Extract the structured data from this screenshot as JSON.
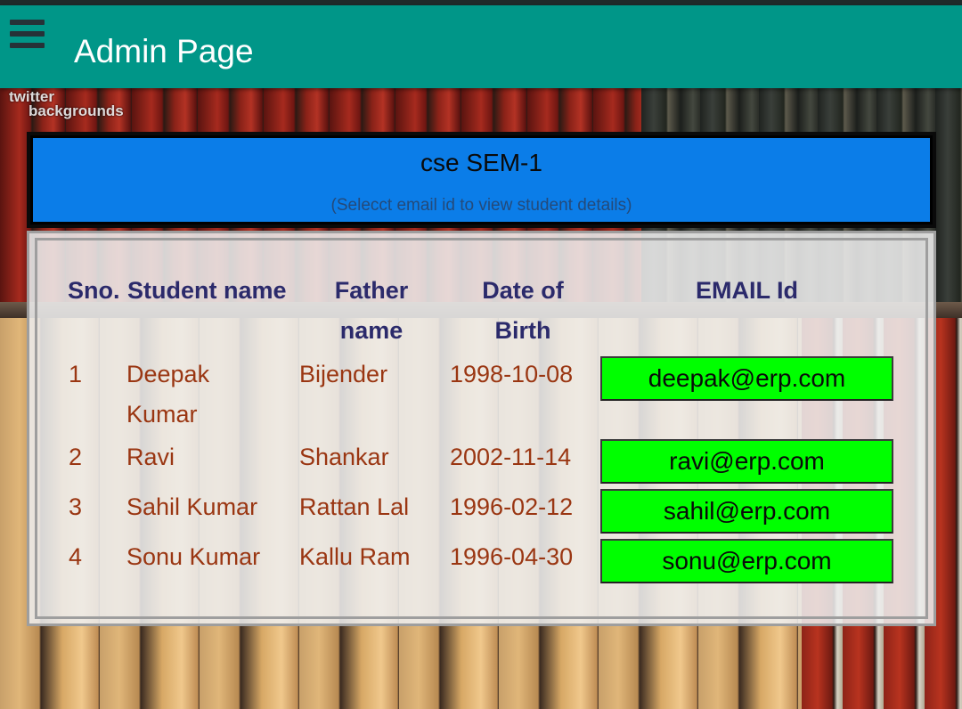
{
  "app_bar": {
    "title": "Admin Page",
    "menu_icon": "hamburger-menu-icon",
    "color": "#009688"
  },
  "background": {
    "watermark_line1": "twitter",
    "watermark_line2": "backgrounds"
  },
  "header": {
    "title": "cse SEM-1",
    "subtitle": "(Selecct email id to view student details)",
    "color": "#0b7de8"
  },
  "table": {
    "columns": {
      "sno": "Sno.",
      "student_name": "Student name",
      "father_name_1": "Father",
      "father_name_2": "name",
      "dob_1": "Date of",
      "dob_2": "Birth",
      "email": "EMAIL Id"
    },
    "rows": [
      {
        "sno": "1",
        "name_1": "Deepak",
        "name_2": "Kumar",
        "father": "Bijender",
        "dob": "1998-10-08",
        "email": "deepak@erp.com"
      },
      {
        "sno": "2",
        "name_1": "Ravi",
        "name_2": "",
        "father": "Shankar",
        "dob": "2002-11-14",
        "email": "ravi@erp.com"
      },
      {
        "sno": "3",
        "name_1": "Sahil Kumar",
        "name_2": "",
        "father": "Rattan Lal",
        "dob": "1996-02-12",
        "email": "sahil@erp.com"
      },
      {
        "sno": "4",
        "name_1": "Sonu Kumar",
        "name_2": "",
        "father": "Kallu Ram",
        "dob": "1996-04-30",
        "email": "sonu@erp.com"
      }
    ],
    "email_button_color": "#00ff00",
    "header_text_color": "#2b2a6b",
    "cell_text_color": "#9a3612"
  }
}
